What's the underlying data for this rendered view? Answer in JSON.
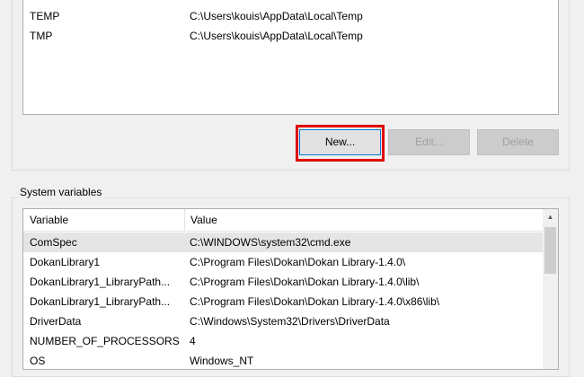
{
  "user_variables": {
    "rows": [
      {
        "variable": "TEMP",
        "value": "C:\\Users\\kouis\\AppData\\Local\\Temp"
      },
      {
        "variable": "TMP",
        "value": "C:\\Users\\kouis\\AppData\\Local\\Temp"
      }
    ],
    "buttons": {
      "new": "New...",
      "edit": "Edit...",
      "delete": "Delete"
    }
  },
  "system_variables": {
    "title": "System variables",
    "columns": {
      "variable": "Variable",
      "value": "Value"
    },
    "rows": [
      {
        "variable": "ComSpec",
        "value": "C:\\WINDOWS\\system32\\cmd.exe"
      },
      {
        "variable": "DokanLibrary1",
        "value": "C:\\Program Files\\Dokan\\Dokan Library-1.4.0\\"
      },
      {
        "variable": "DokanLibrary1_LibraryPath...",
        "value": "C:\\Program Files\\Dokan\\Dokan Library-1.4.0\\lib\\"
      },
      {
        "variable": "DokanLibrary1_LibraryPath...",
        "value": "C:\\Program Files\\Dokan\\Dokan Library-1.4.0\\x86\\lib\\"
      },
      {
        "variable": "DriverData",
        "value": "C:\\Windows\\System32\\Drivers\\DriverData"
      },
      {
        "variable": "NUMBER_OF_PROCESSORS",
        "value": "4"
      },
      {
        "variable": "OS",
        "value": "Windows_NT"
      }
    ],
    "scroll_icon": "chevron-up-icon"
  },
  "colors": {
    "highlight": "#e00000",
    "selected_row": "#e5e5e5",
    "background": "#f0f0f0"
  }
}
